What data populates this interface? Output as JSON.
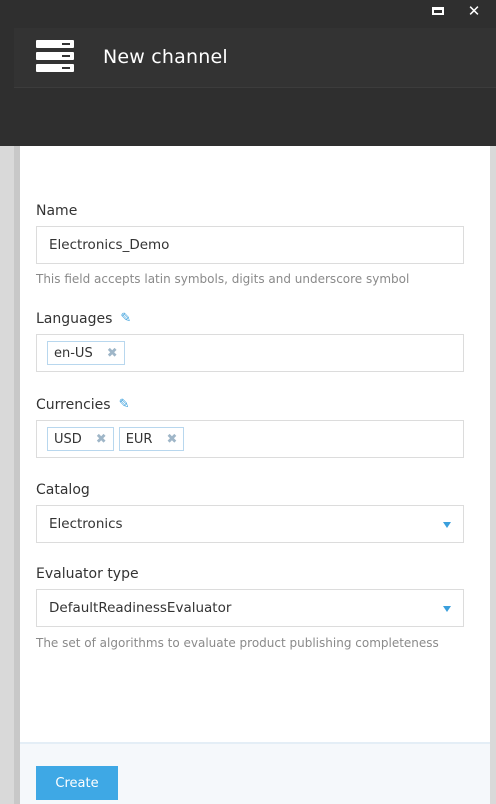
{
  "window": {
    "maximize_icon": "maximize-icon",
    "close_icon": "close-icon"
  },
  "header": {
    "title": "New channel",
    "icon": "blade-icon"
  },
  "form": {
    "name": {
      "label": "Name",
      "value": "Electronics_Demo",
      "hint": "This field accepts latin symbols, digits and underscore symbol"
    },
    "languages": {
      "label": "Languages",
      "edit_icon": "pencil-icon",
      "tags": [
        "en-US"
      ]
    },
    "currencies": {
      "label": "Currencies",
      "edit_icon": "pencil-icon",
      "tags": [
        "USD",
        "EUR"
      ]
    },
    "catalog": {
      "label": "Catalog",
      "value": "Electronics"
    },
    "evaluator": {
      "label": "Evaluator type",
      "value": "DefaultReadinessEvaluator",
      "hint": "The set of algorithms to evaluate product publishing completeness"
    }
  },
  "footer": {
    "create_label": "Create"
  },
  "colors": {
    "accent": "#3ea8e5",
    "header_bg": "#2f2f2f"
  }
}
